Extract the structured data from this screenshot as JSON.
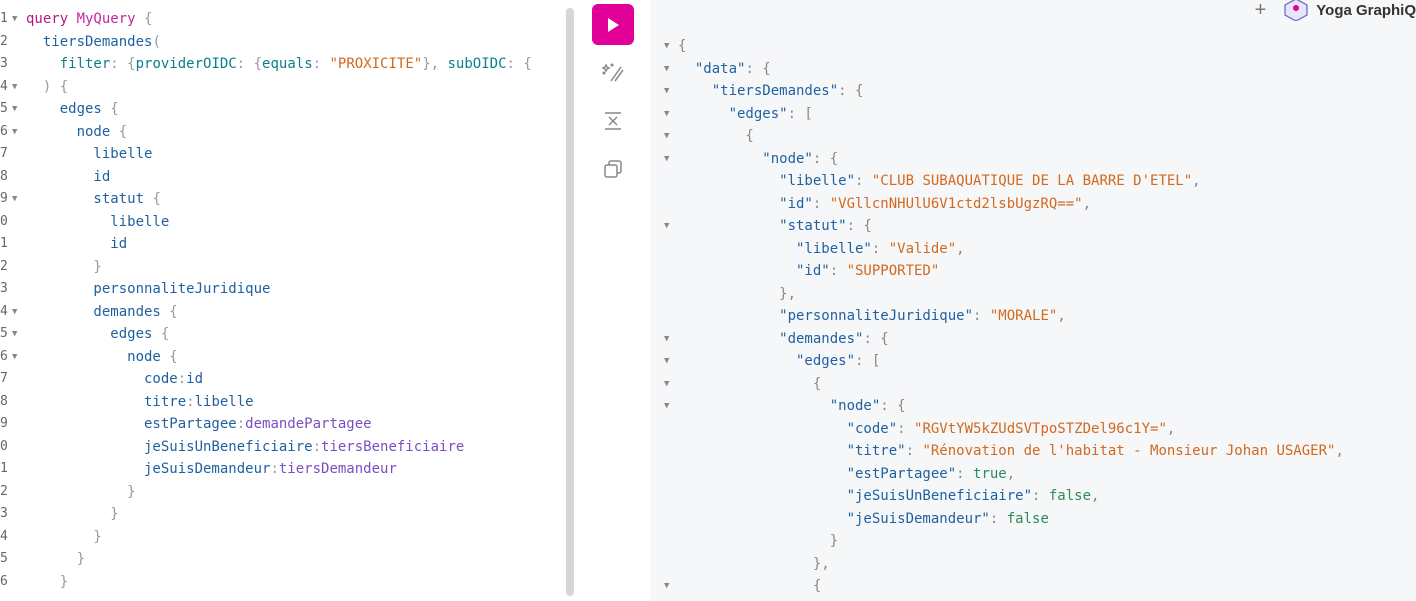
{
  "editor": {
    "lines": [
      {
        "n": "1",
        "fold": true,
        "tokens": [
          {
            "t": "query ",
            "c": "k-kw"
          },
          {
            "t": "MyQuery",
            "c": "k-def"
          },
          {
            "t": " {",
            "c": "k-punc"
          }
        ]
      },
      {
        "n": "2",
        "fold": false,
        "tokens": [
          {
            "t": "  tiersDemandes",
            "c": "k-field"
          },
          {
            "t": "(",
            "c": "k-punc"
          }
        ]
      },
      {
        "n": "3",
        "fold": false,
        "tokens": [
          {
            "t": "    filter",
            "c": "k-arg"
          },
          {
            "t": ": {",
            "c": "k-punc"
          },
          {
            "t": "providerOIDC",
            "c": "k-arg"
          },
          {
            "t": ": {",
            "c": "k-punc"
          },
          {
            "t": "equals",
            "c": "k-arg"
          },
          {
            "t": ": ",
            "c": "k-punc"
          },
          {
            "t": "\"PROXICITE\"",
            "c": "k-str"
          },
          {
            "t": "}, ",
            "c": "k-punc"
          },
          {
            "t": "subOIDC",
            "c": "k-arg"
          },
          {
            "t": ": {",
            "c": "k-punc"
          }
        ]
      },
      {
        "n": "4",
        "fold": true,
        "tokens": [
          {
            "t": "  ) {",
            "c": "k-punc"
          }
        ]
      },
      {
        "n": "5",
        "fold": true,
        "tokens": [
          {
            "t": "    edges",
            "c": "k-field"
          },
          {
            "t": " {",
            "c": "k-punc"
          }
        ]
      },
      {
        "n": "6",
        "fold": true,
        "tokens": [
          {
            "t": "      node",
            "c": "k-field"
          },
          {
            "t": " {",
            "c": "k-punc"
          }
        ]
      },
      {
        "n": "7",
        "fold": false,
        "tokens": [
          {
            "t": "        libelle",
            "c": "k-field"
          }
        ]
      },
      {
        "n": "8",
        "fold": false,
        "tokens": [
          {
            "t": "        id",
            "c": "k-field"
          }
        ]
      },
      {
        "n": "9",
        "fold": true,
        "tokens": [
          {
            "t": "        statut",
            "c": "k-field"
          },
          {
            "t": " {",
            "c": "k-punc"
          }
        ]
      },
      {
        "n": "0",
        "fold": false,
        "tokens": [
          {
            "t": "          libelle",
            "c": "k-field"
          }
        ]
      },
      {
        "n": "1",
        "fold": false,
        "tokens": [
          {
            "t": "          id",
            "c": "k-field"
          }
        ]
      },
      {
        "n": "2",
        "fold": false,
        "tokens": [
          {
            "t": "        }",
            "c": "k-punc"
          }
        ]
      },
      {
        "n": "3",
        "fold": false,
        "tokens": [
          {
            "t": "        personnaliteJuridique",
            "c": "k-field"
          }
        ]
      },
      {
        "n": "4",
        "fold": true,
        "tokens": [
          {
            "t": "        demandes",
            "c": "k-field"
          },
          {
            "t": " {",
            "c": "k-punc"
          }
        ]
      },
      {
        "n": "5",
        "fold": true,
        "tokens": [
          {
            "t": "          edges",
            "c": "k-field"
          },
          {
            "t": " {",
            "c": "k-punc"
          }
        ]
      },
      {
        "n": "6",
        "fold": true,
        "tokens": [
          {
            "t": "            node",
            "c": "k-field"
          },
          {
            "t": " {",
            "c": "k-punc"
          }
        ]
      },
      {
        "n": "7",
        "fold": false,
        "tokens": [
          {
            "t": "              code",
            "c": "k-alias"
          },
          {
            "t": ":",
            "c": "k-punc"
          },
          {
            "t": "id",
            "c": "k-field"
          }
        ]
      },
      {
        "n": "8",
        "fold": false,
        "tokens": [
          {
            "t": "              titre",
            "c": "k-alias"
          },
          {
            "t": ":",
            "c": "k-punc"
          },
          {
            "t": "libelle",
            "c": "k-field"
          }
        ]
      },
      {
        "n": "9",
        "fold": false,
        "tokens": [
          {
            "t": "              estPartagee",
            "c": "k-alias"
          },
          {
            "t": ":",
            "c": "k-punc"
          },
          {
            "t": "demandePartagee",
            "c": "k-var"
          }
        ]
      },
      {
        "n": "0",
        "fold": false,
        "tokens": [
          {
            "t": "              jeSuisUnBeneficiaire",
            "c": "k-alias"
          },
          {
            "t": ":",
            "c": "k-punc"
          },
          {
            "t": "tiersBeneficiaire",
            "c": "k-var"
          }
        ]
      },
      {
        "n": "1",
        "fold": false,
        "tokens": [
          {
            "t": "              jeSuisDemandeur",
            "c": "k-alias"
          },
          {
            "t": ":",
            "c": "k-punc"
          },
          {
            "t": "tiersDemandeur",
            "c": "k-var"
          }
        ]
      },
      {
        "n": "2",
        "fold": false,
        "tokens": [
          {
            "t": "            }",
            "c": "k-punc"
          }
        ]
      },
      {
        "n": "3",
        "fold": false,
        "tokens": [
          {
            "t": "          }",
            "c": "k-punc"
          }
        ]
      },
      {
        "n": "4",
        "fold": false,
        "tokens": [
          {
            "t": "        }",
            "c": "k-punc"
          }
        ]
      },
      {
        "n": "5",
        "fold": false,
        "tokens": [
          {
            "t": "      }",
            "c": "k-punc"
          }
        ]
      },
      {
        "n": "6",
        "fold": false,
        "tokens": [
          {
            "t": "    }",
            "c": "k-punc"
          }
        ]
      }
    ]
  },
  "toolbar": {
    "run_icon": "play-icon",
    "prettify_icon": "magic-wand-icon",
    "merge_icon": "merge-fragments-icon",
    "copy_icon": "copy-icon"
  },
  "header": {
    "plus_label": "+",
    "brand_label": "Yoga GraphiQ"
  },
  "result": {
    "lines": [
      {
        "fold": true,
        "tokens": [
          {
            "t": "{",
            "c": "j-punc"
          }
        ]
      },
      {
        "fold": true,
        "tokens": [
          {
            "t": "  \"data\"",
            "c": "j-key"
          },
          {
            "t": ": {",
            "c": "j-punc"
          }
        ]
      },
      {
        "fold": true,
        "tokens": [
          {
            "t": "    \"tiersDemandes\"",
            "c": "j-key"
          },
          {
            "t": ": {",
            "c": "j-punc"
          }
        ]
      },
      {
        "fold": true,
        "tokens": [
          {
            "t": "      \"edges\"",
            "c": "j-key"
          },
          {
            "t": ": [",
            "c": "j-punc"
          }
        ]
      },
      {
        "fold": true,
        "tokens": [
          {
            "t": "        {",
            "c": "j-punc"
          }
        ]
      },
      {
        "fold": true,
        "tokens": [
          {
            "t": "          \"node\"",
            "c": "j-key"
          },
          {
            "t": ": {",
            "c": "j-punc"
          }
        ]
      },
      {
        "fold": false,
        "tokens": [
          {
            "t": "            \"libelle\"",
            "c": "j-key"
          },
          {
            "t": ": ",
            "c": "j-punc"
          },
          {
            "t": "\"CLUB SUBAQUATIQUE DE LA BARRE D'ETEL\"",
            "c": "j-str"
          },
          {
            "t": ",",
            "c": "j-punc"
          }
        ]
      },
      {
        "fold": false,
        "tokens": [
          {
            "t": "            \"id\"",
            "c": "j-key"
          },
          {
            "t": ": ",
            "c": "j-punc"
          },
          {
            "t": "\"VGllcnNHUlU6V1ctd2lsbUgzRQ==\"",
            "c": "j-str"
          },
          {
            "t": ",",
            "c": "j-punc"
          }
        ]
      },
      {
        "fold": true,
        "tokens": [
          {
            "t": "            \"statut\"",
            "c": "j-key"
          },
          {
            "t": ": {",
            "c": "j-punc"
          }
        ]
      },
      {
        "fold": false,
        "tokens": [
          {
            "t": "              \"libelle\"",
            "c": "j-key"
          },
          {
            "t": ": ",
            "c": "j-punc"
          },
          {
            "t": "\"Valide\"",
            "c": "j-str"
          },
          {
            "t": ",",
            "c": "j-punc"
          }
        ]
      },
      {
        "fold": false,
        "tokens": [
          {
            "t": "              \"id\"",
            "c": "j-key"
          },
          {
            "t": ": ",
            "c": "j-punc"
          },
          {
            "t": "\"SUPPORTED\"",
            "c": "j-str"
          }
        ]
      },
      {
        "fold": false,
        "tokens": [
          {
            "t": "            },",
            "c": "j-punc"
          }
        ]
      },
      {
        "fold": false,
        "tokens": [
          {
            "t": "            \"personnaliteJuridique\"",
            "c": "j-key"
          },
          {
            "t": ": ",
            "c": "j-punc"
          },
          {
            "t": "\"MORALE\"",
            "c": "j-str"
          },
          {
            "t": ",",
            "c": "j-punc"
          }
        ]
      },
      {
        "fold": true,
        "tokens": [
          {
            "t": "            \"demandes\"",
            "c": "j-key"
          },
          {
            "t": ": {",
            "c": "j-punc"
          }
        ]
      },
      {
        "fold": true,
        "tokens": [
          {
            "t": "              \"edges\"",
            "c": "j-key"
          },
          {
            "t": ": [",
            "c": "j-punc"
          }
        ]
      },
      {
        "fold": true,
        "tokens": [
          {
            "t": "                {",
            "c": "j-punc"
          }
        ]
      },
      {
        "fold": true,
        "tokens": [
          {
            "t": "                  \"node\"",
            "c": "j-key"
          },
          {
            "t": ": {",
            "c": "j-punc"
          }
        ]
      },
      {
        "fold": false,
        "tokens": [
          {
            "t": "                    \"code\"",
            "c": "j-key"
          },
          {
            "t": ": ",
            "c": "j-punc"
          },
          {
            "t": "\"RGVtYW5kZUdSVTpoSTZDel96c1Y=\"",
            "c": "j-str"
          },
          {
            "t": ",",
            "c": "j-punc"
          }
        ]
      },
      {
        "fold": false,
        "tokens": [
          {
            "t": "                    \"titre\"",
            "c": "j-key"
          },
          {
            "t": ": ",
            "c": "j-punc"
          },
          {
            "t": "\"Rénovation de l'habitat - Monsieur Johan USAGER\"",
            "c": "j-str"
          },
          {
            "t": ",",
            "c": "j-punc"
          }
        ]
      },
      {
        "fold": false,
        "tokens": [
          {
            "t": "                    \"estPartagee\"",
            "c": "j-key"
          },
          {
            "t": ": ",
            "c": "j-punc"
          },
          {
            "t": "true",
            "c": "j-bool"
          },
          {
            "t": ",",
            "c": "j-punc"
          }
        ]
      },
      {
        "fold": false,
        "tokens": [
          {
            "t": "                    \"jeSuisUnBeneficiaire\"",
            "c": "j-key"
          },
          {
            "t": ": ",
            "c": "j-punc"
          },
          {
            "t": "false",
            "c": "j-bool"
          },
          {
            "t": ",",
            "c": "j-punc"
          }
        ]
      },
      {
        "fold": false,
        "tokens": [
          {
            "t": "                    \"jeSuisDemandeur\"",
            "c": "j-key"
          },
          {
            "t": ": ",
            "c": "j-punc"
          },
          {
            "t": "false",
            "c": "j-bool"
          }
        ]
      },
      {
        "fold": false,
        "tokens": [
          {
            "t": "                  }",
            "c": "j-punc"
          }
        ]
      },
      {
        "fold": false,
        "tokens": [
          {
            "t": "                },",
            "c": "j-punc"
          }
        ]
      },
      {
        "fold": true,
        "tokens": [
          {
            "t": "                {",
            "c": "j-punc"
          }
        ]
      }
    ]
  }
}
